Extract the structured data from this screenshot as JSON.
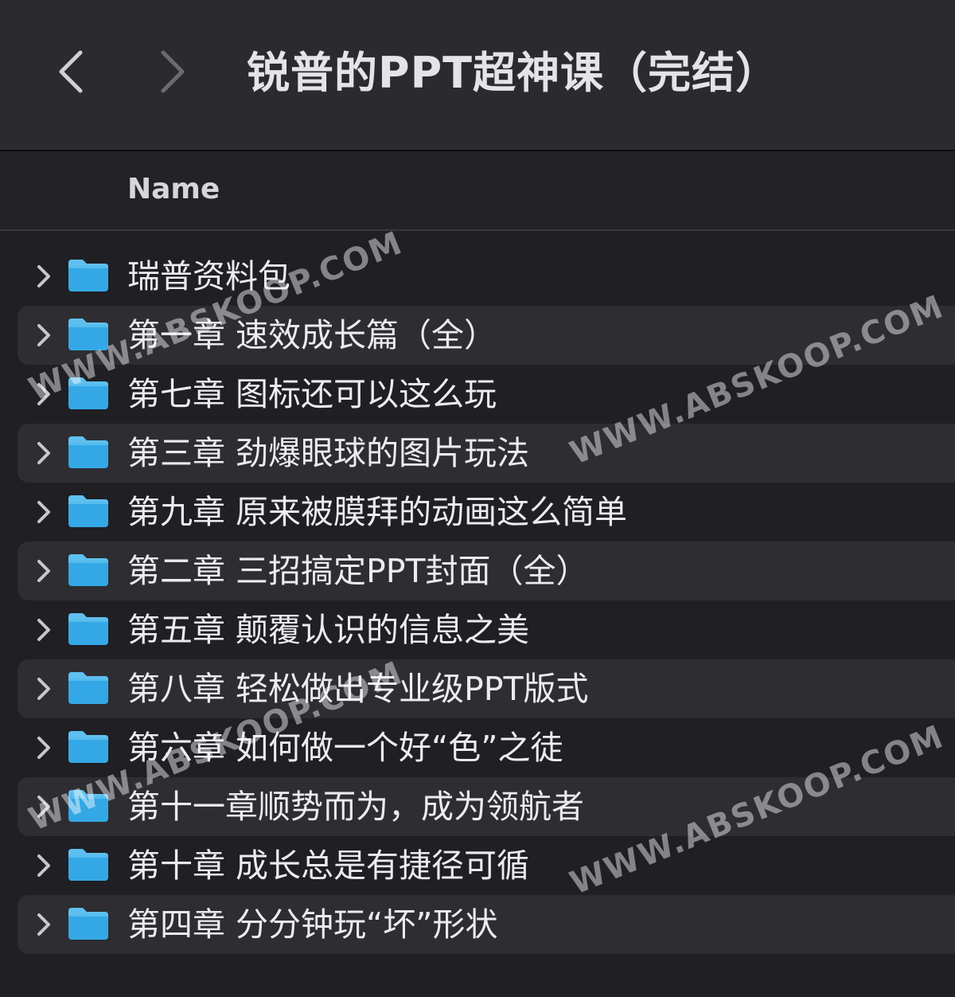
{
  "window": {
    "title": "锐普的PPT超神课（完结）"
  },
  "toolbar": {
    "back_icon": "chevron-left-icon",
    "forward_icon": "chevron-right-icon"
  },
  "table": {
    "column_name": "Name"
  },
  "items": [
    {
      "label": "瑞普资料包"
    },
    {
      "label": "第一章 速效成长篇（全）"
    },
    {
      "label": "第七章 图标还可以这么玩"
    },
    {
      "label": "第三章 劲爆眼球的图片玩法"
    },
    {
      "label": "第九章 原来被膜拜的动画这么简单"
    },
    {
      "label": "第二章  三招搞定PPT封面（全）"
    },
    {
      "label": "第五章 颠覆认识的信息之美"
    },
    {
      "label": "第八章 轻松做出专业级PPT版式"
    },
    {
      "label": "第六章 如何做一个好“色”之徒"
    },
    {
      "label": "第十一章顺势而为，成为领航者"
    },
    {
      "label": "第十章 成长总是有捷径可循"
    },
    {
      "label": "第四章 分分钟玩“坏”形状"
    }
  ],
  "watermarks": [
    "WWW.ABSKOOP.COM",
    "WWW.ABSKOOP.COM",
    "WWW.ABSKOOP.COM",
    "WWW.ABSKOOP.COM"
  ],
  "colors": {
    "folder": "#34a8e6",
    "folder_tab": "#5fc0f0",
    "window_bg": "#1f1f24",
    "toolbar_bg": "#2b2b2f",
    "alt_row": "#2d2d32"
  }
}
